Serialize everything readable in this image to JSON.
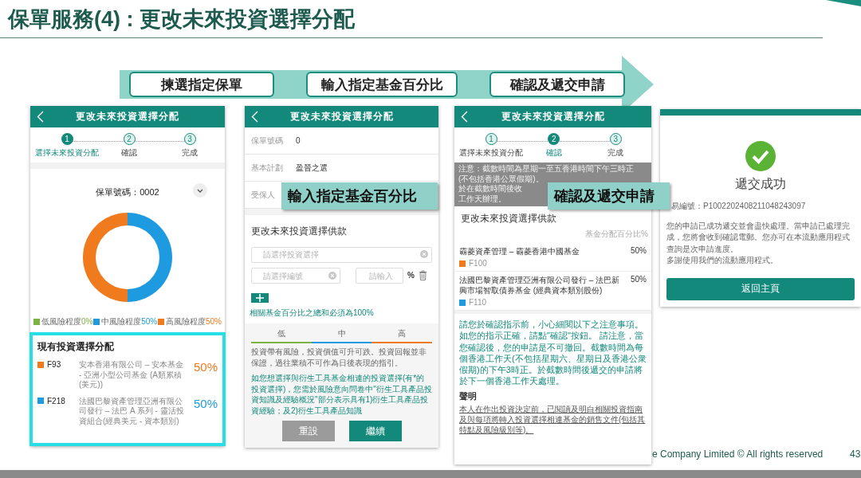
{
  "slide_title": "保單服務(4) : 更改未來投資選擇分配",
  "process_steps": [
    "揀選指定保單",
    "輸入指定基金百分比",
    "確認及遞交申請"
  ],
  "screen_1": {
    "header_title": "更改未來投資選擇分配",
    "steps": [
      {
        "number": "1",
        "label": "選擇未來投資分配",
        "selected": true
      },
      {
        "number": "2",
        "label": "確認",
        "selected": false
      },
      {
        "number": "3",
        "label": "完成",
        "selected": false
      }
    ],
    "policy_number": "保單號碼：0002",
    "chart_data": {
      "type": "donut",
      "categories": [
        "低風險程度",
        "中風險程度",
        "高風險程度"
      ],
      "values": [
        0,
        50,
        50
      ]
    },
    "legend": [
      {
        "value": "0%",
        "color": "#7cb342"
      },
      {
        "value": "50%",
        "color": "#1e9be0"
      },
      {
        "value": "50%",
        "color": "#f07a1e"
      }
    ],
    "allocation": {
      "title": "現有投資選擇分配",
      "funds": [
        {
          "code": "F93",
          "name": "安本香港有限公司 – 安本基金 - 亞洲小型公司基金 (A類累積(美元))",
          "percent": "50%",
          "color": "#f07a1e"
        },
        {
          "code": "F218",
          "name": "法國巴黎資產管理亞洲有限公司發行 – 法巴 A 系列 - 靈活投資組合(經典美元 - 資本類別)",
          "percent": "50%",
          "color": "#1e9be0"
        }
      ]
    }
  },
  "screen_2": {
    "header_title": "更改未來投資選擇分配",
    "fields": [
      {
        "label": "保單號碼",
        "value": "0"
      },
      {
        "label": "基本計劃",
        "value": "盈晉之選"
      },
      {
        "label": "受保人"
      }
    ],
    "section_title": "更改未來投資選擇供款",
    "fund_select": {
      "placeholder": "請選擇投資選擇"
    },
    "code_select": {
      "placeholder": "請選擇編號"
    },
    "percent_input": {
      "placeholder": "請輸入"
    },
    "percent_sign": "%",
    "hint": "相關基金百分比之總和必須為100%",
    "risk_scale": [
      {
        "label": "低",
        "color": "#7cb342"
      },
      {
        "label": "中",
        "color": "#1e9be0"
      },
      {
        "label": "高",
        "color": "#f07a1e"
      }
    ],
    "disclaimer": "投資帶有風險，投資價值可升可跌。投資回報並非保證，過往業積不可作為日後表現的指引。",
    "derivative_note": "如您想選擇與衍生工具基金相連的投資選擇(有*的投資選擇)，您需於風險意向問卷中\"衍生工具產品投資知識及經驗概況\"部分表示具有1)衍生工具產品投資經驗；及2)衍生工具產品知識",
    "buttons": [
      {
        "label": "重設",
        "kind": "secondary"
      },
      {
        "label": "繼續",
        "kind": "primary"
      }
    ]
  },
  "screen_3": {
    "header_title": "更改未來投資選擇分配",
    "steps": [
      {
        "number": "1",
        "label": "選擇未來投資分配",
        "selected": false
      },
      {
        "number": "2",
        "label": "確認",
        "selected": true
      },
      {
        "number": "3",
        "label": "完成",
        "selected": false
      }
    ],
    "notice": [
      "注意：截數時間為星期一至五香港時間下午三時正",
      "(不包括香港公眾假期)。",
      "於在截數時間後收",
      "工作天辦理。"
    ],
    "section_title": "更改未來投資選擇供款",
    "column_label": "基金分配百分比%",
    "funds": [
      {
        "name": "霸菱資產管理 – 霸菱香港中國基金",
        "percent": "50%",
        "code": "F100",
        "color": "#f07a1e"
      },
      {
        "name": "法國巴黎資產管理亞洲有限公司發行 – 法巴新興市場智取債券基金 (經典資本類別股份)",
        "percent": "50%",
        "code": "F110",
        "color": "#1e9be0"
      }
    ],
    "confirm_note": "請您於確認指示前，小心細閱以下之注意事項。如您的指示正確，請點\"確認\"按鈕。 請注意，當您確認後，您的申請是不可撤回。截數時間為每個香港工作天(不包括星期六、星期日及香港公衆假期)的下午3時正。於截數時間後遞交的申請將於下一個香港工作天處理。",
    "declaration_title": "聲明",
    "declaration": "本人在作出投資決定前，已閱讀及明白相關投資指南及與每項將轉入投資選擇相連基金的銷售文件(包括其特點及風險級別等)。"
  },
  "screen_4": {
    "title": "遞交成功",
    "transaction": "易編號：P1002202408211048243097",
    "message": "您的申請已成功遞交並會盡快處理。當申請已處理完成，您將會收到確認電郵。您亦可在本流動應用程式查詢是次申請進度。",
    "thanks": "多謝使用我們的流動應用程式。",
    "button": "返回主頁"
  },
  "callouts": [
    "輸入指定基金百分比",
    "確認及遞交申請"
  ],
  "footer": {
    "copyright": "e Company Limited © All rights reserved",
    "page_number": "43"
  }
}
